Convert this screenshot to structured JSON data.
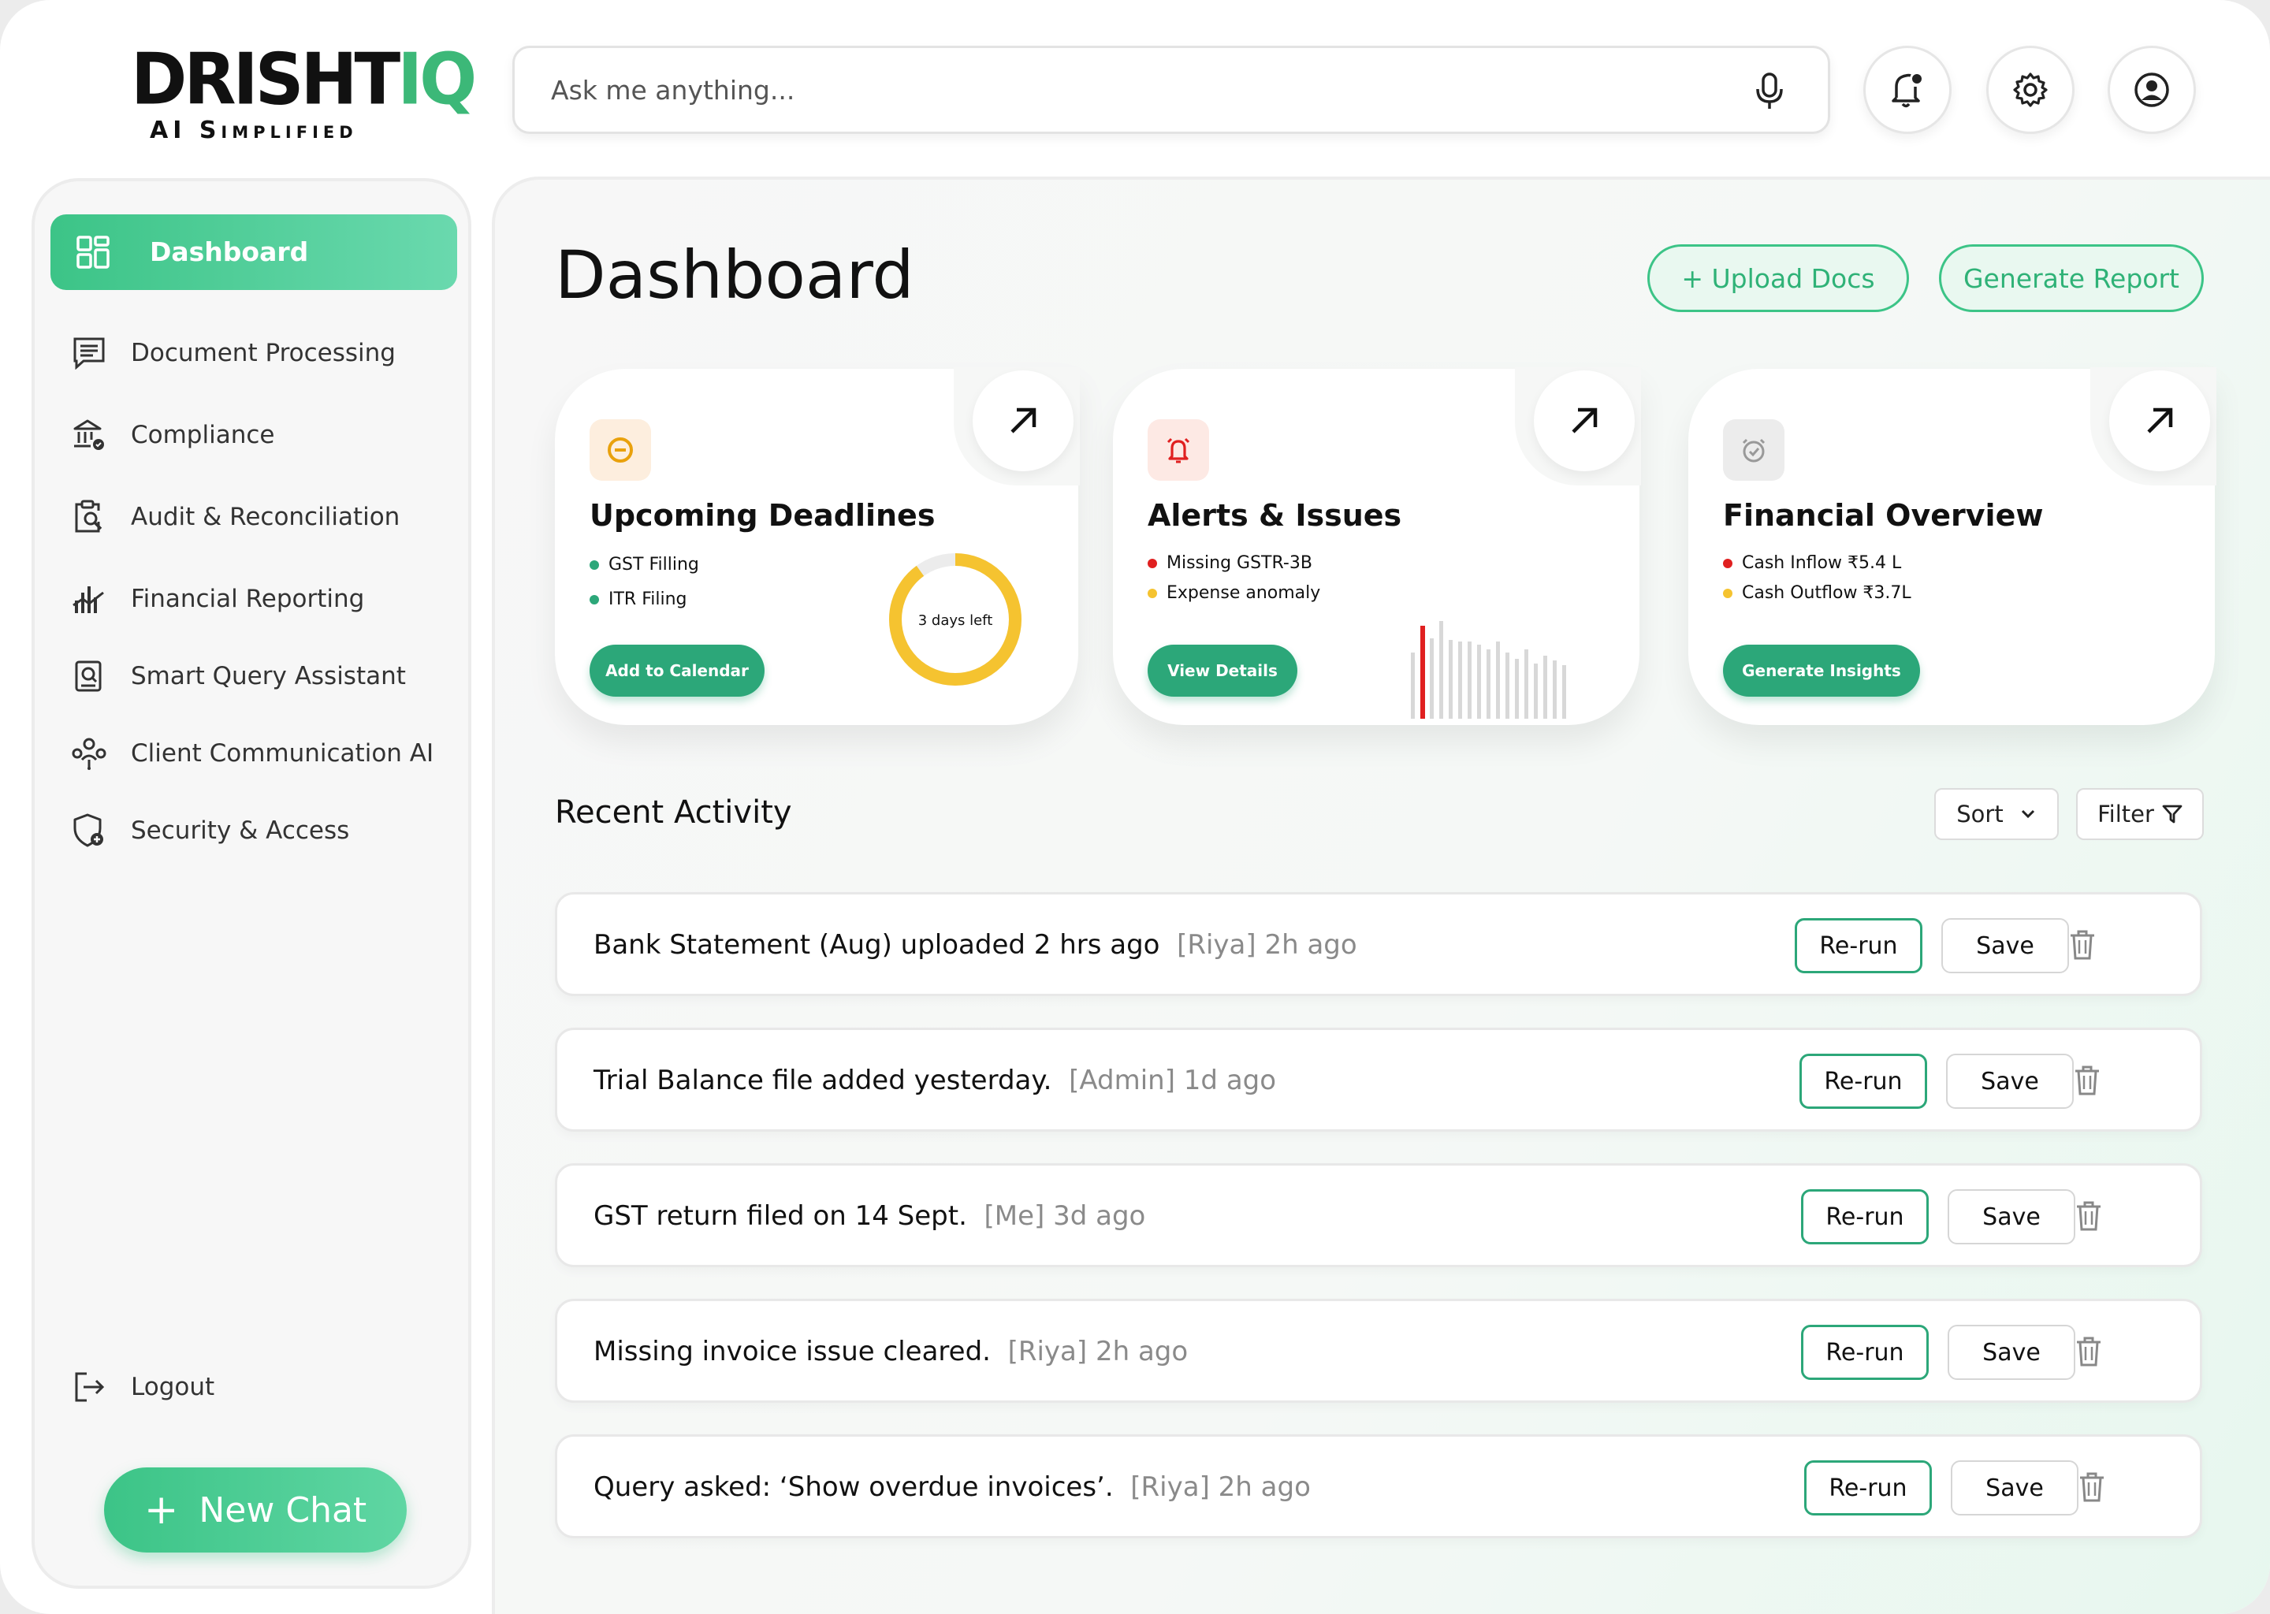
{
  "brand": {
    "name_main": "DRISHT",
    "name_accent": "IQ",
    "tagline": "AI Simplified",
    "accent_color": "#3cb878"
  },
  "search": {
    "placeholder": "Ask me anything..."
  },
  "header_icons": [
    "bell-icon",
    "gear-icon",
    "user-icon"
  ],
  "sidebar": {
    "items": [
      {
        "label": "Dashboard",
        "icon": "grid-icon",
        "active": true
      },
      {
        "label": "Document Processing",
        "icon": "document-icon"
      },
      {
        "label": "Compliance",
        "icon": "bank-icon"
      },
      {
        "label": "Audit & Reconciliation",
        "icon": "clipboard-search-icon"
      },
      {
        "label": "Financial Reporting",
        "icon": "chart-icon"
      },
      {
        "label": "Smart Query Assistant",
        "icon": "query-icon"
      },
      {
        "label": "Client Communication AI",
        "icon": "people-icon"
      },
      {
        "label": "Security & Access",
        "icon": "shield-icon"
      }
    ],
    "logout": "Logout",
    "new_chat": "New Chat"
  },
  "main": {
    "title": "Dashboard",
    "upload_label": "+ Upload Docs",
    "report_label": "Generate Report",
    "cards": [
      {
        "title": "Upcoming Deadlines",
        "items": [
          "GST Filling",
          "ITR Filing"
        ],
        "button": "Add to Calendar",
        "ring_label": "3 days left",
        "ring_fraction": 0.9
      },
      {
        "title": "Alerts & Issues",
        "items": [
          "Missing GSTR-3B",
          "Expense anomaly"
        ],
        "button": "View Details"
      },
      {
        "title": "Financial Overview",
        "items": [
          "Cash Inflow ₹5.4 L",
          "Cash Outflow ₹3.7L"
        ],
        "button": "Generate Insights"
      }
    ],
    "recent": {
      "title": "Recent Activity",
      "sort_label": "Sort",
      "filter_label": "Filter",
      "rerun_label": "Re-run",
      "save_label": "Save",
      "rows": [
        {
          "text": "Bank Statement (Aug) uploaded 2 hrs ago",
          "meta": "[Riya]  2h ago"
        },
        {
          "text": "Trial Balance file added yesterday.",
          "meta": "[Admin] 1d ago"
        },
        {
          "text": "GST return filed on 14 Sept.",
          "meta": "[Me]  3d ago"
        },
        {
          "text": "Missing invoice issue cleared.",
          "meta": "[Riya]  2h ago"
        },
        {
          "text": "Query asked: ‘Show overdue invoices’.",
          "meta": "[Riya]  2h ago"
        }
      ]
    }
  },
  "colors": {
    "primary": "#3cc487",
    "button_dark": "#2ca779",
    "alert_red": "#e02020",
    "warn_yellow": "#f5c330"
  }
}
